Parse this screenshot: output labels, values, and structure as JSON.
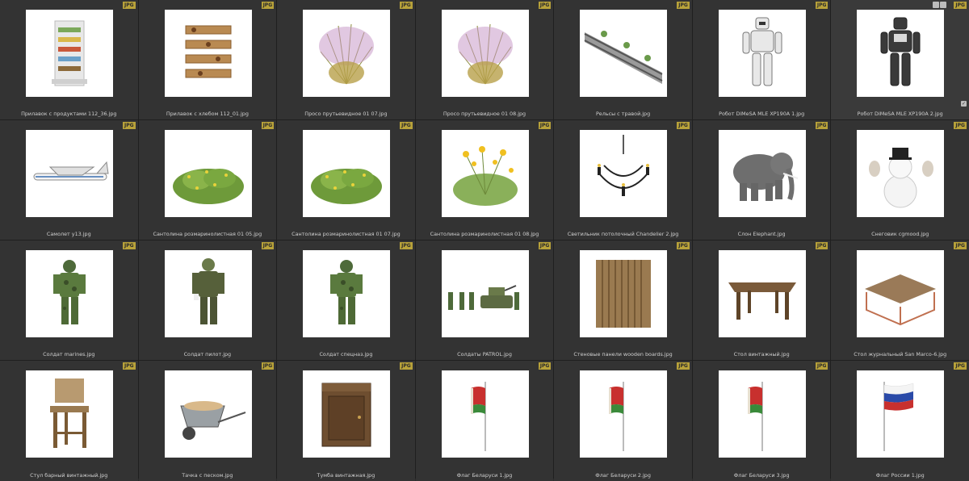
{
  "badge": "JPG",
  "items": [
    {
      "caption": "Прилавок с продуктами 112_36.jpg",
      "icon": "shelf-products-icon"
    },
    {
      "caption": "Прилавок с хлебом 112_01.jpg",
      "icon": "bread-stand-icon"
    },
    {
      "caption": "Просо прутьевидное 01 07.jpg",
      "icon": "grass-pink-icon"
    },
    {
      "caption": "Просо прутьевидное 01 08.jpg",
      "icon": "grass-pink-icon"
    },
    {
      "caption": "Рельсы с травой.jpg",
      "icon": "rails-icon"
    },
    {
      "caption": "Робот DiMeSA MLE XP190A 1.jpg",
      "icon": "robot-white-icon"
    },
    {
      "caption": "Робот DiMeSA MLE XP190A 2.jpg",
      "icon": "robot-dark-icon"
    },
    {
      "caption": "Самолет y13.jpg",
      "icon": "airplane-icon"
    },
    {
      "caption": "Сантолина розмаринолистная 01 05.jpg",
      "icon": "bush-icon"
    },
    {
      "caption": "Сантолина розмаринолистная 01 07.jpg",
      "icon": "bush-icon"
    },
    {
      "caption": "Сантолина розмаринолистная 01 08.jpg",
      "icon": "bush-flowers-icon"
    },
    {
      "caption": "Светильник потолочный Chandelier 2.jpg",
      "icon": "chandelier-icon"
    },
    {
      "caption": "Слон Elephant.jpg",
      "icon": "elephant-icon"
    },
    {
      "caption": "Снеговик cgmood.jpg",
      "icon": "snowman-icon"
    },
    {
      "caption": "Солдат marines.jpg",
      "icon": "soldier-icon"
    },
    {
      "caption": "Солдат пилот.jpg",
      "icon": "pilot-icon"
    },
    {
      "caption": "Солдат спецназ.jpg",
      "icon": "soldier-icon"
    },
    {
      "caption": "Солдаты PATROL.jpg",
      "icon": "patrol-icon"
    },
    {
      "caption": "Стеновые панели wooden boards.jpg",
      "icon": "wooden-panels-icon"
    },
    {
      "caption": "Стол винтажный.jpg",
      "icon": "table-icon"
    },
    {
      "caption": "Стол журнальный San Marco-6.jpg",
      "icon": "coffee-table-icon"
    },
    {
      "caption": "Стул барный винтажный.jpg",
      "icon": "bar-stool-icon"
    },
    {
      "caption": "Тачка с песком.jpg",
      "icon": "wheelbarrow-icon"
    },
    {
      "caption": "Тумба винтажная.jpg",
      "icon": "cabinet-icon"
    },
    {
      "caption": "Флаг Беларуси 1.jpg",
      "icon": "flag-belarus-icon"
    },
    {
      "caption": "Флаг Беларуси 2.jpg",
      "icon": "flag-belarus-icon"
    },
    {
      "caption": "Флаг Беларуси 3.jpg",
      "icon": "flag-belarus-icon"
    },
    {
      "caption": "Флаг России 1.jpg",
      "icon": "flag-russia-icon"
    }
  ]
}
